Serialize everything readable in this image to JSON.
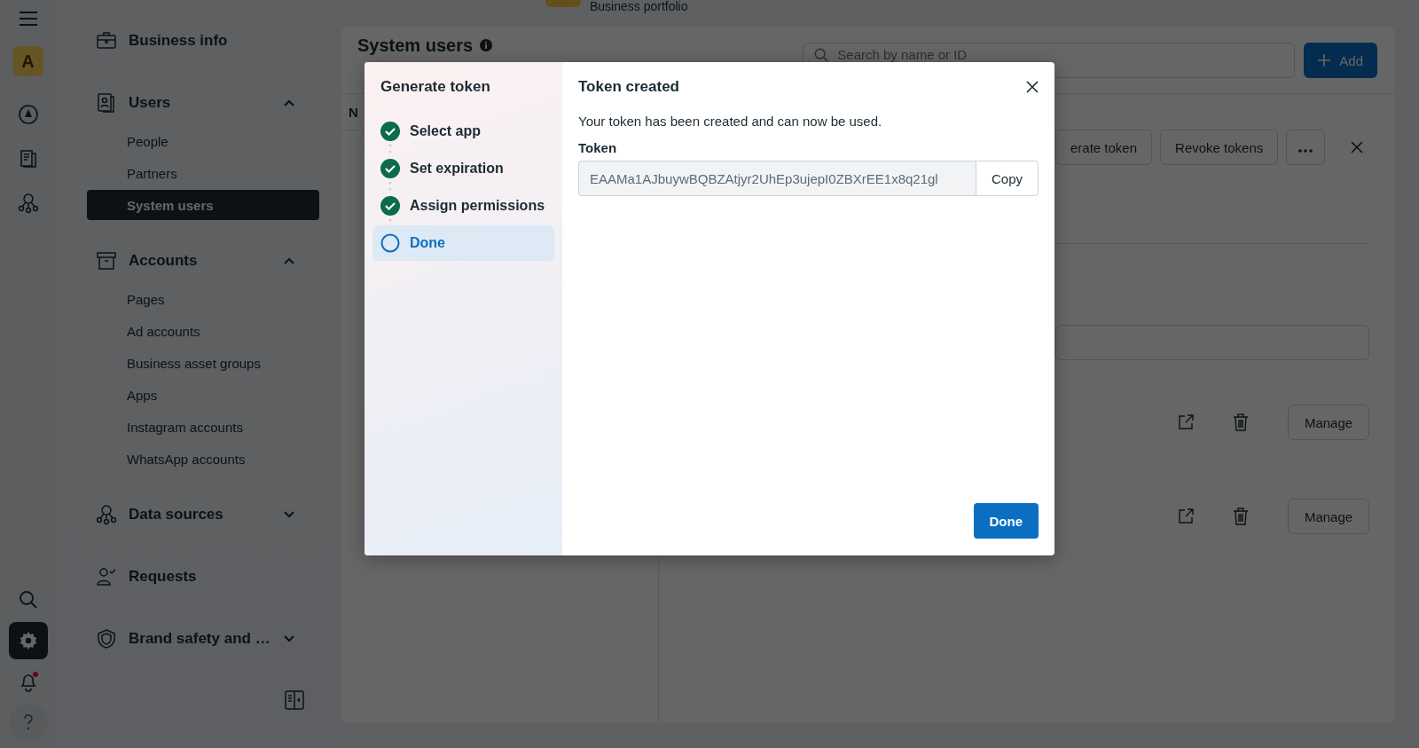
{
  "top_bar": {
    "portfolio": "Business portfolio"
  },
  "rail": {
    "avatar": "A",
    "nav": [
      {
        "kind": "compass",
        "selected": false
      },
      {
        "kind": "pages",
        "selected": false
      },
      {
        "kind": "network",
        "selected": false
      }
    ],
    "bottom": [
      {
        "kind": "search",
        "selected": false
      },
      {
        "kind": "settings",
        "selected": true
      },
      {
        "kind": "bell",
        "selected": false,
        "badge": true
      },
      {
        "kind": "help",
        "selected": false
      }
    ]
  },
  "sidebar": {
    "sections": [
      {
        "label": "Business info",
        "kind": "link"
      },
      {
        "label": "Users",
        "kind": "group",
        "expanded": true,
        "children": [
          {
            "label": "People",
            "selected": false
          },
          {
            "label": "Partners",
            "selected": false
          },
          {
            "label": "System users",
            "selected": true
          }
        ]
      },
      {
        "label": "Accounts",
        "kind": "group",
        "expanded": true,
        "children": [
          {
            "label": "Pages",
            "selected": false
          },
          {
            "label": "Ad accounts",
            "selected": false
          },
          {
            "label": "Business asset groups",
            "selected": false
          },
          {
            "label": "Apps",
            "selected": false
          },
          {
            "label": "Instagram accounts",
            "selected": false
          },
          {
            "label": "WhatsApp accounts",
            "selected": false
          }
        ]
      },
      {
        "label": "Data sources",
        "kind": "group",
        "expanded": false
      },
      {
        "label": "Requests",
        "kind": "link"
      },
      {
        "label": "Brand safety and …",
        "kind": "group",
        "expanded": false
      }
    ]
  },
  "main": {
    "title": "System users",
    "search": {
      "placeholder": "Search by name or ID"
    },
    "add_button": "Add",
    "column_1": "N",
    "actions": [
      "erate token",
      "Revoke tokens"
    ],
    "assets": [
      {
        "button": "Manage"
      },
      {
        "button": "Manage"
      }
    ]
  },
  "modal": {
    "steps_title": "Generate token",
    "steps": [
      {
        "label": "Select app",
        "done": true,
        "selected": false
      },
      {
        "label": "Set expiration",
        "done": true,
        "selected": false
      },
      {
        "label": "Assign permissions",
        "done": true,
        "selected": false
      },
      {
        "label": "Done",
        "done": false,
        "selected": true
      }
    ],
    "title": "Token created",
    "message": "Your token has been created and can now be used.",
    "token_label": "Token",
    "token_value": "EAAMa1AJbuywBQBZAtjyr2UhEp3ujepI0ZBXrEE1x8q21gl",
    "copy_button": "Copy",
    "done_button": "Done"
  }
}
